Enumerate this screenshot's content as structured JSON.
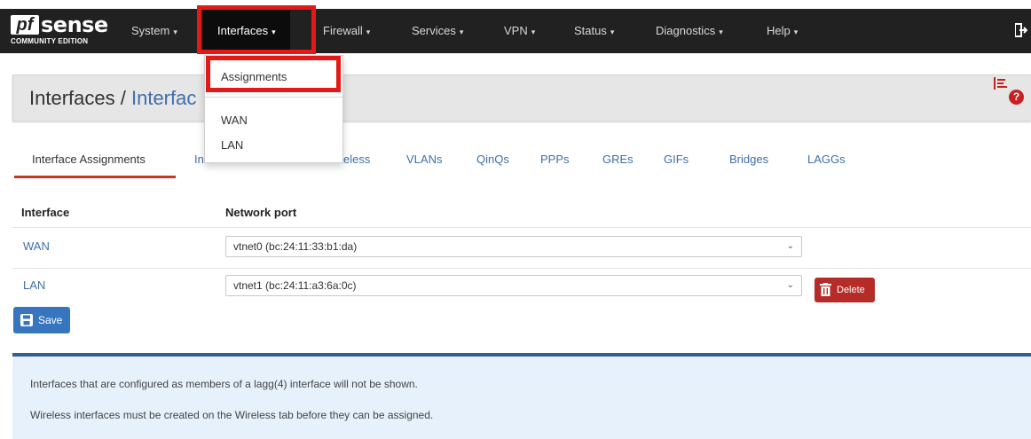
{
  "brand": {
    "logo_pf": "pf",
    "logo_sense": "sense",
    "logo_edition": "COMMUNITY EDITION"
  },
  "nav": {
    "items": [
      {
        "label": "System"
      },
      {
        "label": "Interfaces"
      },
      {
        "label": "Firewall"
      },
      {
        "label": "Services"
      },
      {
        "label": "VPN"
      },
      {
        "label": "Status"
      },
      {
        "label": "Diagnostics"
      },
      {
        "label": "Help"
      }
    ],
    "active": "Interfaces",
    "caret": "▾"
  },
  "dropdown": {
    "items": [
      {
        "label": "Assignments"
      },
      {
        "label": "WAN"
      },
      {
        "label": "LAN"
      }
    ]
  },
  "header": {
    "crumb_root": "Interfaces",
    "separator": "/",
    "crumb_current": "Interfac",
    "help_icon": "?"
  },
  "tabs": {
    "items": [
      {
        "label": "Interface Assignments"
      },
      {
        "label": "In"
      },
      {
        "label": "eless"
      },
      {
        "label": "VLANs"
      },
      {
        "label": "QinQs"
      },
      {
        "label": "PPPs"
      },
      {
        "label": "GREs"
      },
      {
        "label": "GIFs"
      },
      {
        "label": "Bridges"
      },
      {
        "label": "LAGGs"
      }
    ],
    "active": "Interface Assignments"
  },
  "table": {
    "headers": {
      "interface": "Interface",
      "network_port": "Network port"
    },
    "rows": [
      {
        "interface": "WAN",
        "port": "vtnet0 (bc:24:11:33:b1:da)"
      },
      {
        "interface": "LAN",
        "port": "vtnet1 (bc:24:11:a3:6a:0c)"
      }
    ],
    "chevron": "⌄"
  },
  "buttons": {
    "delete_label": "Delete",
    "save_label": "Save"
  },
  "info": {
    "line1": "Interfaces that are configured as members of a lagg(4) interface will not be shown.",
    "line2": "Wireless interfaces must be created on the Wireless tab before they can be assigned."
  },
  "colors": {
    "navbar": "#212121",
    "highlight": "#e31919",
    "link": "#3f6fa9",
    "delete": "#b52b27",
    "save": "#3776be",
    "info_bg": "#e6f1fb"
  }
}
